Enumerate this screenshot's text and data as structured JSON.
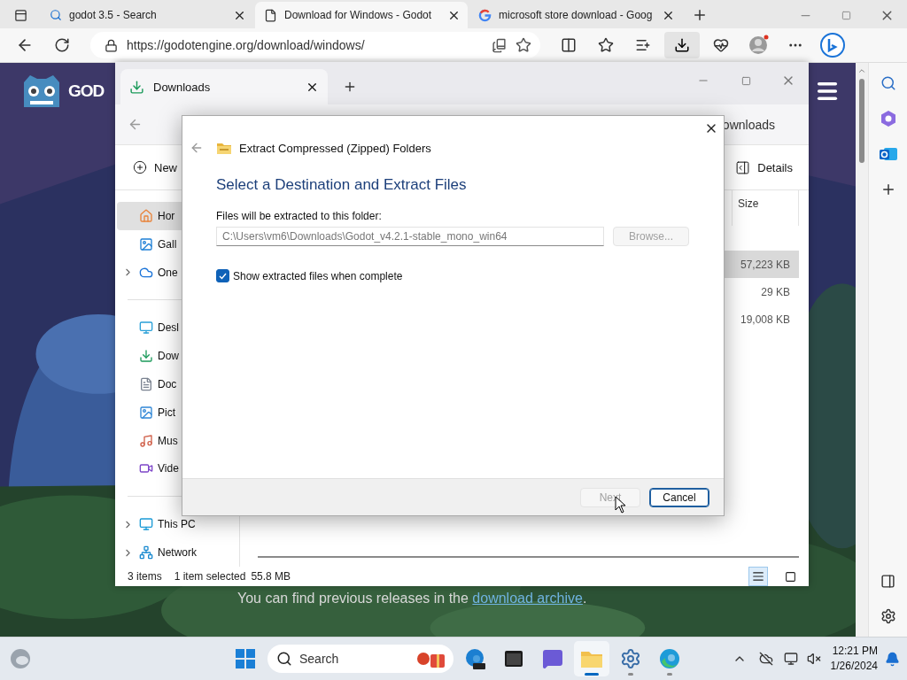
{
  "browser": {
    "tabs": [
      {
        "title": "godot 3.5 - Search",
        "selected": false
      },
      {
        "title": "Download for Windows - Godot",
        "selected": true
      },
      {
        "title": "microsoft store download - Goog",
        "selected": false
      }
    ],
    "address": "https://godotengine.org/download/windows/"
  },
  "page": {
    "logo_text": "GOD",
    "archive": {
      "before": "You can find previous releases in the ",
      "link": "download archive",
      "after": "."
    }
  },
  "explorer": {
    "tab": "Downloads",
    "search": "ownloads",
    "new_button": "New",
    "details_button": "Details",
    "nav": [
      {
        "label": "Hor",
        "selected": true,
        "expandable": false
      },
      {
        "label": "Gall",
        "selected": false,
        "expandable": false
      },
      {
        "label": "One",
        "selected": false,
        "expandable": true
      },
      {
        "label": "Desl",
        "selected": false,
        "expandable": false
      },
      {
        "label": "Dow",
        "selected": false,
        "expandable": false
      },
      {
        "label": "Doc",
        "selected": false,
        "expandable": false
      },
      {
        "label": "Pict",
        "selected": false,
        "expandable": false
      },
      {
        "label": "Mus",
        "selected": false,
        "expandable": false
      },
      {
        "label": "Vide",
        "selected": false,
        "expandable": false
      },
      {
        "label": "This PC",
        "selected": false,
        "expandable": true
      },
      {
        "label": "Network",
        "selected": false,
        "expandable": true
      }
    ],
    "size_header": "Size",
    "sizes": [
      {
        "text": "57,223 KB",
        "selected": true
      },
      {
        "text": "29 KB",
        "selected": false
      },
      {
        "text": "19,008 KB",
        "selected": false
      }
    ],
    "status": {
      "items": "3 items",
      "selection": "1 item selected",
      "size": "55.8 MB"
    },
    "views": [
      {
        "kind": "details",
        "selected": true
      },
      {
        "kind": "tiles",
        "selected": false
      }
    ]
  },
  "dialog": {
    "title": "Extract Compressed (Zipped) Folders",
    "heading": "Select a Destination and Extract Files",
    "field_label": "Files will be extracted to this folder:",
    "path": "C:\\Users\\vm6\\Downloads\\Godot_v4.2.1-stable_mono_win64",
    "browse": {
      "label": "Browse...",
      "disabled": true
    },
    "show_files": {
      "label": "Show extracted files when complete",
      "checked": true
    },
    "buttons": [
      {
        "label": "Next",
        "disabled": true,
        "default": false
      },
      {
        "label": "Cancel",
        "disabled": false,
        "default": true
      }
    ]
  },
  "taskbar": {
    "search": {
      "placeholder": "Search"
    },
    "apps": [
      {
        "active": false,
        "running": false
      },
      {
        "active": false,
        "running": false
      },
      {
        "active": false,
        "running": false
      },
      {
        "active": true,
        "running": true
      },
      {
        "active": false,
        "running": true
      },
      {
        "active": false,
        "running": true
      }
    ],
    "time": "12:21 PM",
    "date": "1/26/2024"
  }
}
